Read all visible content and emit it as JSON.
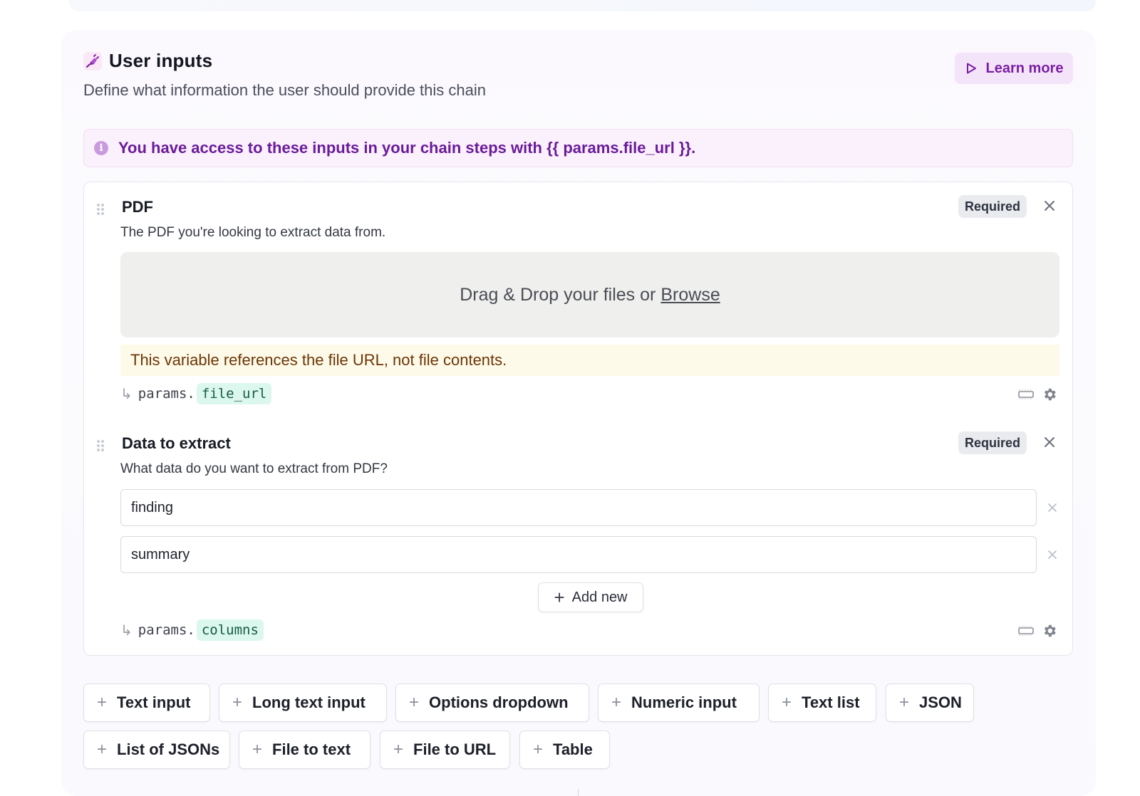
{
  "section": {
    "title": "User inputs",
    "subtitle": "Define what information the user should provide this chain",
    "learn_more_label": "Learn more"
  },
  "info_banner": {
    "text": "You have access to these inputs in your chain steps with {{ params.file_url }}."
  },
  "fields": [
    {
      "title": "PDF",
      "description": "The PDF you're looking to extract data from.",
      "badge": "Required",
      "dropzone_text": "Drag & Drop your files or",
      "dropzone_link": "Browse",
      "warning": "This variable references the file URL, not file contents.",
      "param_prefix": "params.",
      "param_key": "file_url"
    },
    {
      "title": "Data to extract",
      "description": "What data do you want to extract from PDF?",
      "badge": "Required",
      "items": [
        "finding",
        "summary"
      ],
      "add_new_label": "Add new",
      "param_prefix": "params.",
      "param_key": "columns"
    }
  ],
  "input_types": [
    "Text input",
    "Long text input",
    "Options dropdown",
    "Numeric input",
    "Text list",
    "JSON",
    "List of JSONs",
    "File to text",
    "File to URL",
    "Table"
  ],
  "icons": {
    "logo": "plug-logo-icon",
    "learn_more": "play-icon",
    "info": "info-icon",
    "close": "close-icon",
    "drag": "drag-handle-icon",
    "input_style": "input-box-icon",
    "settings": "gear-icon",
    "remove": "remove-icon",
    "add": "plus-icon"
  },
  "colors": {
    "accent_purple": "#7b1fa2",
    "info_text": "#6a1b9a",
    "param_key_bg": "#dcf7ee",
    "warning_bg": "#fefaea"
  }
}
